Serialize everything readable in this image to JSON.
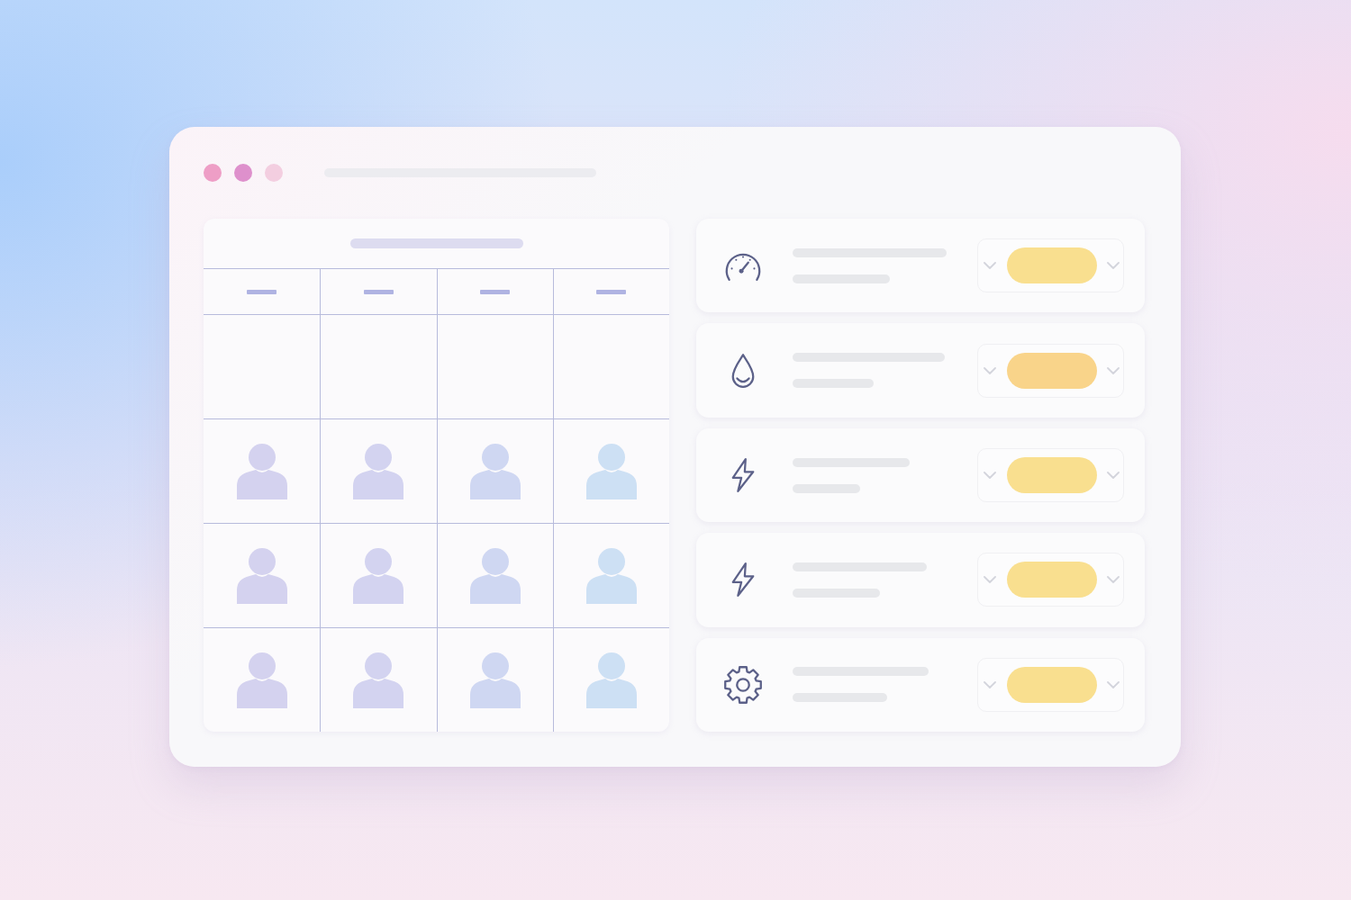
{
  "window": {
    "controls": [
      {
        "color": "#ee9ec6"
      },
      {
        "color": "#de90cc"
      },
      {
        "color": "#f3cee0"
      }
    ]
  },
  "table": {
    "columns": [
      {
        "kind": "placeholder"
      },
      {
        "kind": "placeholder"
      },
      {
        "kind": "placeholder"
      },
      {
        "kind": "placeholder"
      }
    ],
    "rows": [
      {
        "kind": "blank"
      },
      {
        "kind": "avatars"
      },
      {
        "kind": "avatars"
      },
      {
        "kind": "avatars"
      }
    ]
  },
  "settings": [
    {
      "kind": "gauge",
      "color": "#f9df8f"
    },
    {
      "kind": "drop",
      "color": "#f9d48a"
    },
    {
      "kind": "bolt",
      "color": "#f9df8f"
    },
    {
      "kind": "bolt",
      "color": "#f9df8f"
    },
    {
      "kind": "gear",
      "color": "#f9df8f"
    }
  ]
}
